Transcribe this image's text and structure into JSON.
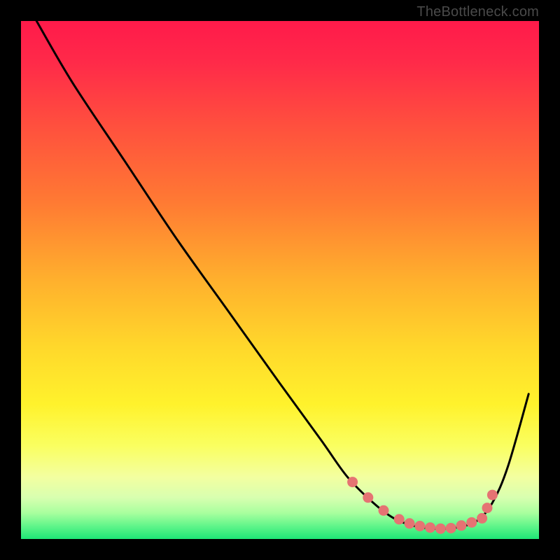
{
  "attribution": "TheBottleneck.com",
  "colors": {
    "red_top": "#ff1a4a",
    "orange": "#ff8a2a",
    "yellow": "#ffe82a",
    "pale": "#f8ffb8",
    "green": "#1ee676",
    "line": "#000000",
    "marker": "#e57373",
    "frame": "#000000"
  },
  "chart_data": {
    "type": "line",
    "title": "",
    "xlabel": "",
    "ylabel": "",
    "xlim": [
      0,
      100
    ],
    "ylim": [
      0,
      100
    ],
    "series": [
      {
        "name": "curve",
        "x": [
          3,
          10,
          20,
          30,
          40,
          50,
          58,
          63,
          68,
          72,
          76,
          80,
          84,
          88,
          91,
          94,
          98
        ],
        "y": [
          100,
          88,
          73,
          58,
          44,
          30,
          19,
          12,
          7,
          4,
          2.5,
          2,
          2.2,
          3.5,
          7,
          14,
          28
        ]
      }
    ],
    "markers": {
      "name": "highlight",
      "x": [
        64,
        67,
        70,
        73,
        75,
        77,
        79,
        81,
        83,
        85,
        87,
        89,
        90,
        91
      ],
      "y": [
        11,
        8,
        5.5,
        3.8,
        3,
        2.5,
        2.2,
        2,
        2.1,
        2.6,
        3.2,
        4,
        6,
        8.5
      ]
    }
  }
}
